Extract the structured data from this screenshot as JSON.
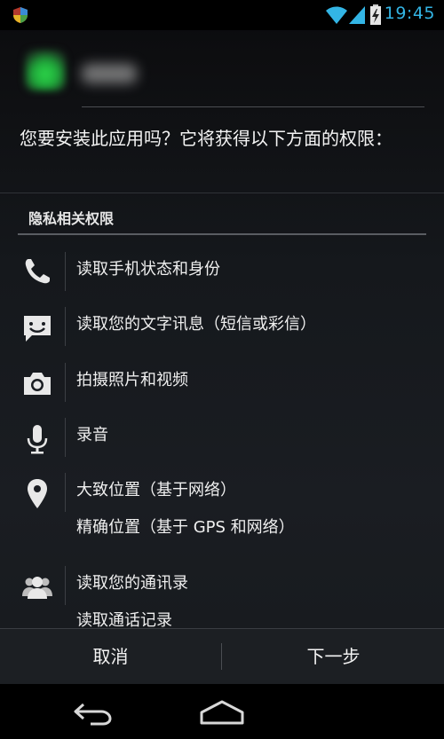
{
  "status_bar": {
    "time": "19:45",
    "icons": [
      "shield-icon",
      "wifi-icon",
      "signal-icon",
      "battery-charging-icon"
    ],
    "accent_color": "#33b5e5"
  },
  "install": {
    "prompt": "您要安装此应用吗？它将获得以下方面的权限："
  },
  "section": {
    "title": "隐私相关权限"
  },
  "permissions": [
    {
      "icon": "phone-icon",
      "lines": [
        "读取手机状态和身份"
      ]
    },
    {
      "icon": "message-icon",
      "lines": [
        "读取您的文字讯息（短信或彩信）"
      ]
    },
    {
      "icon": "camera-icon",
      "lines": [
        "拍摄照片和视频"
      ]
    },
    {
      "icon": "microphone-icon",
      "lines": [
        "录音"
      ]
    },
    {
      "icon": "location-pin-icon",
      "lines": [
        "大致位置（基于网络）",
        "精确位置（基于 GPS 和网络）"
      ]
    },
    {
      "icon": "contacts-icon",
      "lines": [
        "读取您的通讯录",
        "读取通话记录"
      ]
    }
  ],
  "buttons": {
    "cancel": "取消",
    "next": "下一步"
  },
  "nav": {
    "icons": [
      "back-icon",
      "home-icon"
    ]
  }
}
